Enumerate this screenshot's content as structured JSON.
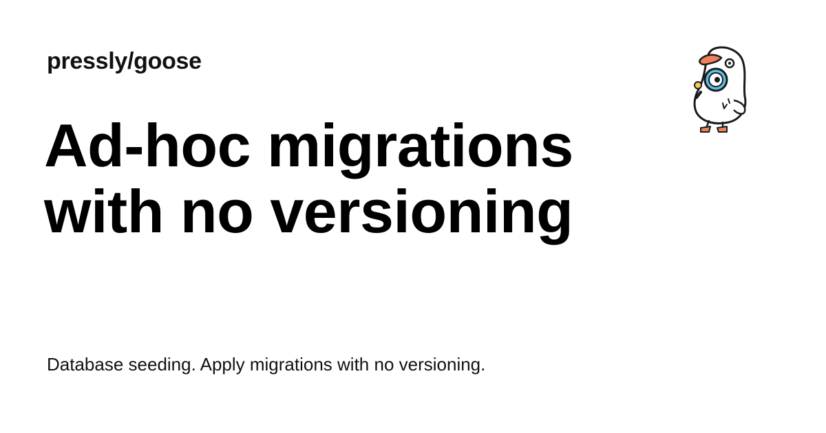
{
  "card": {
    "site_name": "pressly/goose",
    "title": "Ad-hoc migrations with no versioning",
    "description": "Database seeding. Apply migrations with no versioning.",
    "mascot_icon": "goose-mascot-icon"
  },
  "colors": {
    "background": "#ffffff",
    "text": "#000000",
    "mascot_beak": "#f0815c",
    "mascot_lens": "#5bbfe8"
  }
}
